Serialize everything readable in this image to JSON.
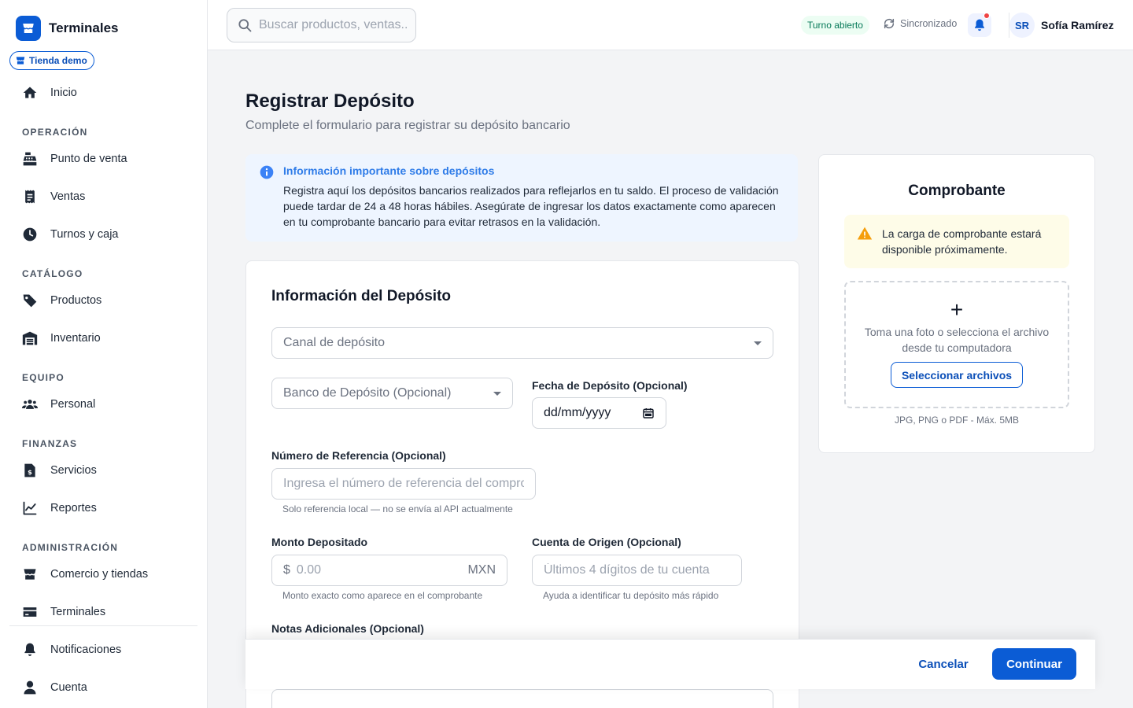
{
  "sidebar": {
    "brand": "Terminales",
    "store_badge": "Tienda demo",
    "home": "Inicio",
    "sections": {
      "operacion": "OPERACIÓN",
      "catalogo": "CATÁLOGO",
      "equipo": "EQUIPO",
      "finanzas": "FINANZAS",
      "administracion": "ADMINISTRACIÓN"
    },
    "items": {
      "pos": "Punto de venta",
      "ventas": "Ventas",
      "turnos": "Turnos y caja",
      "productos": "Productos",
      "inventario": "Inventario",
      "personal": "Personal",
      "servicios": "Servicios",
      "reportes": "Reportes",
      "comercio": "Comercio y tiendas",
      "terminales": "Terminales",
      "notificaciones": "Notificaciones",
      "cuenta": "Cuenta"
    }
  },
  "header": {
    "search_placeholder": "Buscar productos, ventas...",
    "shift_status": "Turno abierto",
    "sync_status": "Sincronizado",
    "user_initials": "SR",
    "user_name": "Sofía Ramírez"
  },
  "main": {
    "title": "Registrar Depósito",
    "subtitle": "Complete el formulario para registrar su depósito bancario",
    "info": {
      "title": "Información importante sobre depósitos",
      "text": "Registra aquí los depósitos bancarios realizados para reflejarlos en tu saldo. El proceso de validación puede tardar de 24 a 48 horas hábiles. Asegúrate de ingresar los datos exactamente como aparecen en tu comprobante bancario para evitar retrasos en la validación."
    },
    "form": {
      "title": "Información del Depósito",
      "channel_placeholder": "Canal de depósito",
      "bank_placeholder": "Banco de Depósito (Opcional)",
      "date_label": "Fecha de Depósito (Opcional)",
      "date_value": "dd/mm/yyyy",
      "reference_label": "Número de Referencia (Opcional)",
      "reference_placeholder": "Ingresa el número de referencia del comprobante",
      "reference_helper": "Solo referencia local — no se envía al API actualmente",
      "amount_label": "Monto Depositado",
      "amount_prefix": "$",
      "amount_placeholder": "0.00",
      "amount_suffix": "MXN",
      "amount_helper": "Monto exacto como aparece en el comprobante",
      "account_label": "Cuenta de Origen (Opcional)",
      "account_placeholder": "Últimos 4 dígitos de tu cuenta",
      "account_helper": "Ayuda a identificar tu depósito más rápido",
      "notes_label": "Notas Adicionales (Opcional)"
    }
  },
  "receipt": {
    "title": "Comprobante",
    "warning": "La carga de comprobante estará disponible próximamente.",
    "drop_text": "Toma una foto o selecciona el archivo desde tu computadora",
    "select_button": "Seleccionar archivos",
    "file_hint": "JPG, PNG o PDF - Máx. 5MB"
  },
  "footer": {
    "cancel": "Cancelar",
    "continue": "Continuar"
  },
  "colors": {
    "primary": "#0b5cd5",
    "info_bg": "#eef5ff",
    "warning_bg": "#fefce8",
    "success_text": "#047857",
    "notification_dot": "#ef4444"
  }
}
